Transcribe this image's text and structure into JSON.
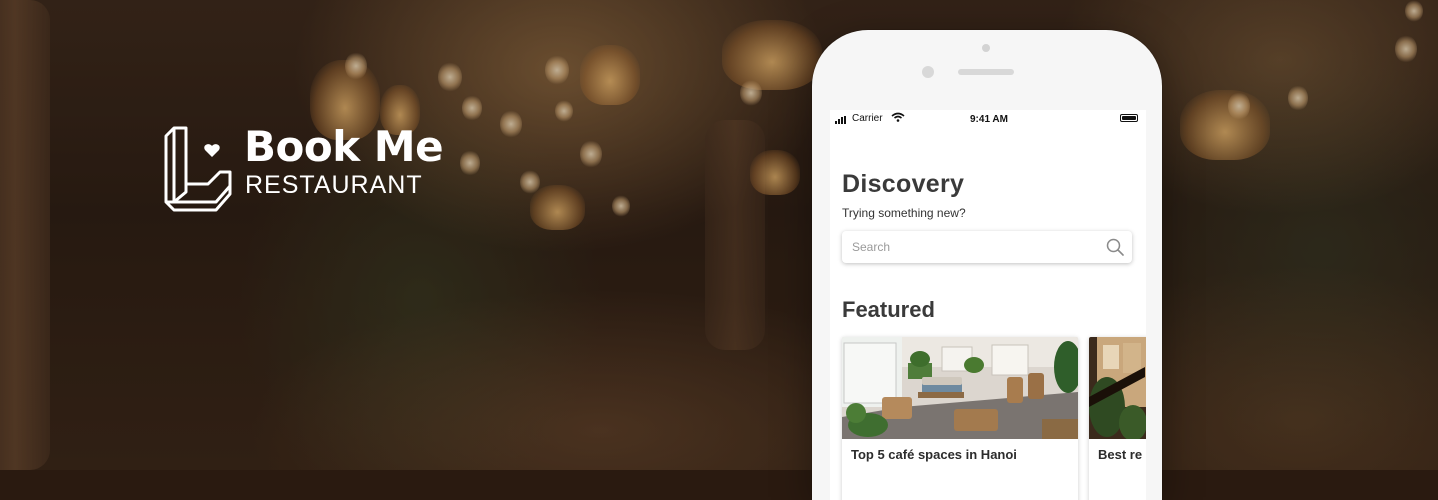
{
  "brand": {
    "name": "Book Me",
    "subtitle": "RESTAURANT",
    "color": "#ffffff"
  },
  "status_bar": {
    "carrier": "Carrier",
    "time": "9:41 AM"
  },
  "discovery": {
    "title": "Discovery",
    "subtitle": "Trying something new?",
    "search_placeholder": "Search"
  },
  "featured": {
    "title": "Featured",
    "cards": [
      {
        "title": "Top 5 café spaces in Hanoi",
        "subtitle": ""
      },
      {
        "title": "Best re",
        "subtitle": ""
      }
    ]
  },
  "icons": [
    "book-me-logo-icon",
    "signal-icon",
    "wifi-icon",
    "battery-icon",
    "search-icon"
  ]
}
